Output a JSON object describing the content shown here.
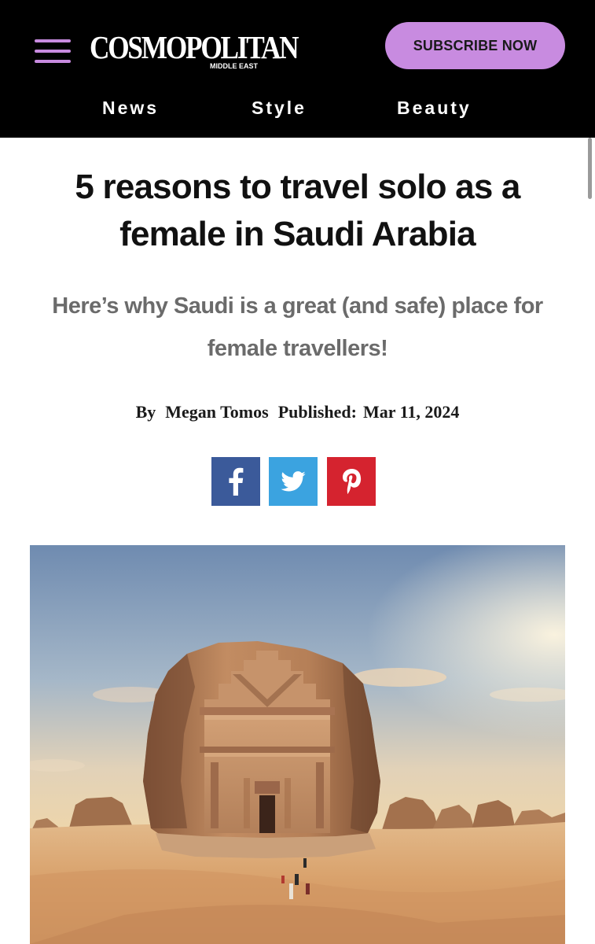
{
  "header": {
    "logo": {
      "name": "COSMOPOLITAN",
      "sub": "MIDDLE EAST"
    },
    "menu_icon": "hamburger-menu-icon",
    "subscribe_label": "SUBSCRIBE NOW",
    "nav": [
      {
        "label": "News"
      },
      {
        "label": "Style"
      },
      {
        "label": "Beauty"
      }
    ]
  },
  "article": {
    "title": "5 reasons to travel solo as a female in Saudi Arabia",
    "subtitle": "Here’s why Saudi is a great (and safe) place for female travellers!",
    "byline": {
      "by": "By",
      "author": "Megan Tomos",
      "published_label": "Published:",
      "date": "Mar 11, 2024"
    },
    "share": [
      {
        "network": "facebook",
        "icon": "facebook-icon"
      },
      {
        "network": "twitter",
        "icon": "twitter-icon"
      },
      {
        "network": "pinterest",
        "icon": "pinterest-icon"
      }
    ]
  },
  "colors": {
    "header_bg": "#000000",
    "accent_lilac": "#c88be0",
    "facebook": "#3b5a9a",
    "twitter": "#3ba3e0",
    "pinterest": "#d5232f",
    "subtitle_gray": "#6b6b6b"
  }
}
